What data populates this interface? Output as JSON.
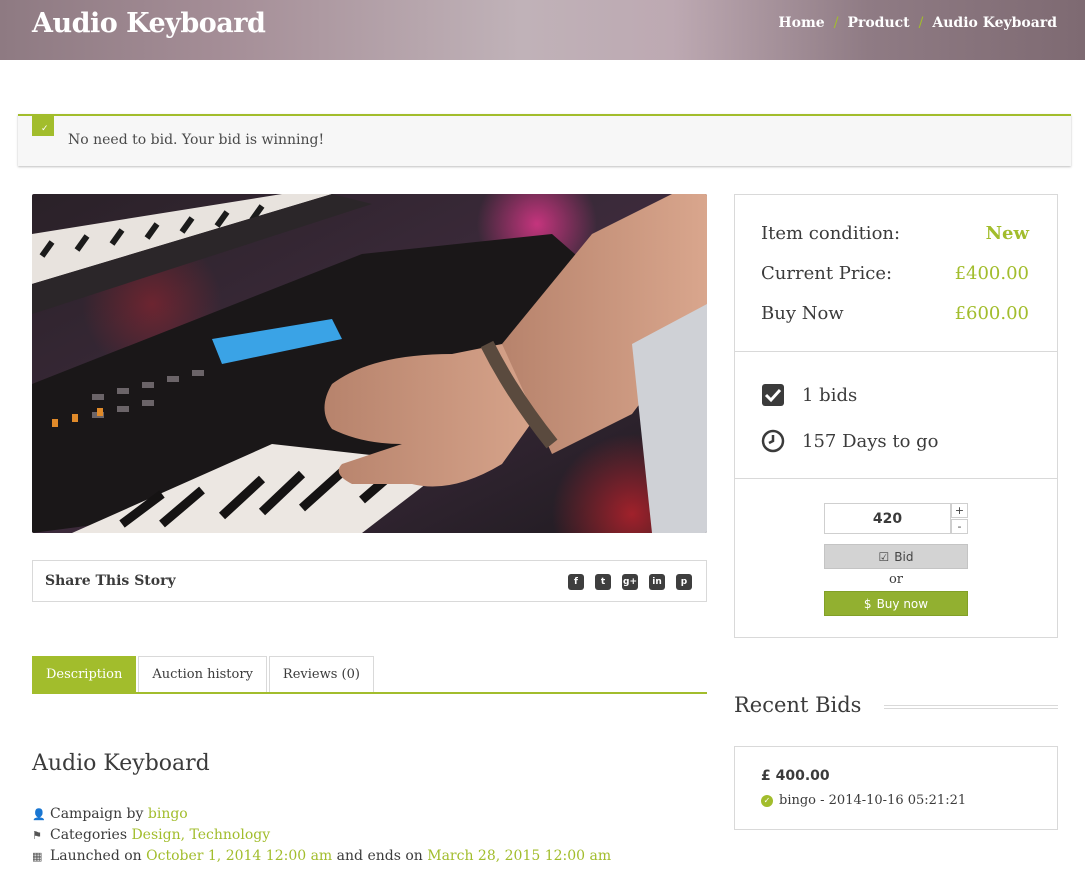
{
  "header": {
    "title": "Audio Keyboard",
    "breadcrumb": [
      {
        "label": "Home"
      },
      {
        "label": "Product"
      },
      {
        "label": "Audio Keyboard"
      }
    ],
    "separator": "/"
  },
  "notice": {
    "message": "No need to bid. Your bid is winning!"
  },
  "share": {
    "label": "Share This Story",
    "icons": [
      "facebook-icon",
      "twitter-icon",
      "google-plus-icon",
      "linkedin-icon",
      "pinterest-icon"
    ]
  },
  "tabs": [
    {
      "label": "Description",
      "active": true
    },
    {
      "label": "Auction history",
      "active": false
    },
    {
      "label": "Reviews (0)",
      "active": false
    }
  ],
  "description": {
    "title": "Audio Keyboard",
    "campaign_prefix": "Campaign by",
    "campaign_user": "bingo",
    "categories_prefix": "Categories",
    "categories": "Design, Technology",
    "launched_prefix": "Launched on",
    "launched_date": "October 1, 2014 12:00 am",
    "ends_prefix": "and ends on",
    "ends_date": "March 28, 2015 12:00 am"
  },
  "auction": {
    "condition_label": "Item condition:",
    "condition_value": "New",
    "price_label": "Current Price:",
    "price_value": "£400.00",
    "buynow_label": "Buy Now",
    "buynow_value": "£600.00",
    "bids_text": "1 bids",
    "days_text": "157 Days to go",
    "bid_amount": "420",
    "bid_button": "Bid",
    "or_text": "or",
    "buy_button": "Buy now"
  },
  "recent_bids": {
    "title": "Recent Bids",
    "items": [
      {
        "amount": "£ 400.00",
        "entry": "bingo - 2014-10-16 05:21:21"
      }
    ]
  },
  "colors": {
    "accent": "#a2bd2c",
    "buy_button": "#92b030",
    "text": "#3b3b3b"
  }
}
